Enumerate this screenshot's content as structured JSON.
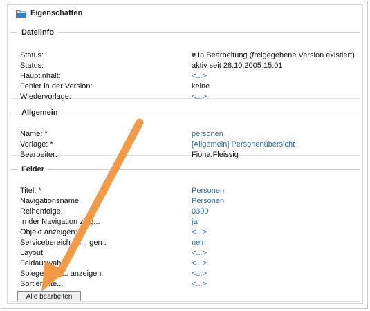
{
  "window": {
    "title": "Eigenschaften",
    "icon": "open-folder-icon"
  },
  "dateiinfo": {
    "legend": "Dateiinfo",
    "rows": [
      {
        "label": "Status:",
        "value": "In Bearbeitung (freigegebene Version existiert)"
      },
      {
        "label": "Status:",
        "value": "aktiv seit 28.10.2005 15:01"
      },
      {
        "label": "Hauptinhalt:",
        "value": "<...>"
      },
      {
        "label": "Fehler in der Version:",
        "value": "keine"
      },
      {
        "label": "Wiedervorlage:",
        "value": "<...>"
      }
    ]
  },
  "allgemein": {
    "legend": "Allgemein",
    "rows": [
      {
        "label": "Name: *",
        "value": "personen"
      },
      {
        "label": "Vorlage: *",
        "value": "[Allgemein] Personenübersicht"
      },
      {
        "label": "Bearbeiter:",
        "value": "Fiona.Fleissig"
      }
    ]
  },
  "felder": {
    "legend": "Felder",
    "rows": [
      {
        "label": "Titel: *",
        "value": "Personen"
      },
      {
        "label": "Navigationsname:",
        "value": "Personen"
      },
      {
        "label": "Reihenfolge:",
        "value": "0300"
      },
      {
        "label": "In der Navigation zeig...",
        "value": "ja"
      },
      {
        "label": "Objekt anzeigen:",
        "value": "<...>"
      },
      {
        "label": "Servicebereich an... gen :",
        "value": "nein"
      },
      {
        "label": "Layout:",
        "value": "<...>"
      },
      {
        "label": "Feldauswahl:",
        "value": "<...>"
      },
      {
        "label": "Spiegeldatei... anzeigen:",
        "value": "<...>"
      },
      {
        "label": "Sortierkrite...",
        "value": "<...>"
      }
    ],
    "button_label": "Alle bearbeiten"
  },
  "colors": {
    "link": "#2f69a8",
    "annotation_arrow": "#f29a48",
    "folder_icon": "#3a7cc8"
  }
}
